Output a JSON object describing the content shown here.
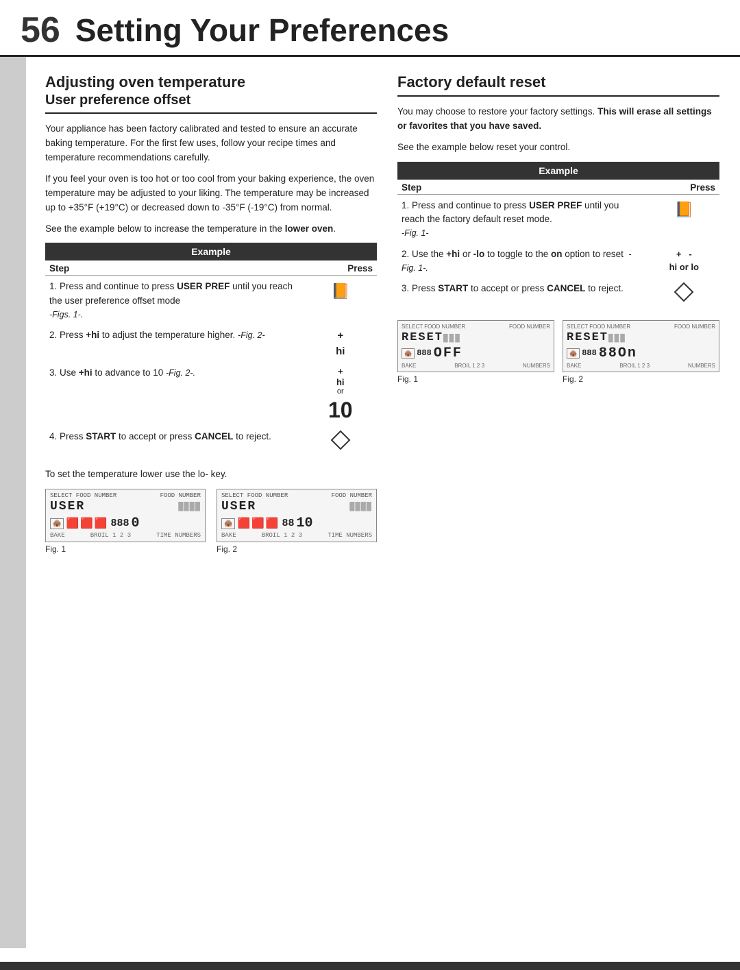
{
  "header": {
    "page_number": "56",
    "title": "Setting Your Preferences"
  },
  "left_section": {
    "title": "Adjusting oven temperature",
    "subtitle": "User preference offset",
    "paragraphs": [
      "Your appliance has been factory calibrated and tested to ensure an accurate baking temperature. For the first few uses, follow your recipe times and temperature recommendations carefully.",
      "If you feel your oven is too hot or too cool from your baking experience, the oven temperature may be adjusted to your liking. The temperature may be increased  up to +35°F (+19°C) or decreased down to -35°F (-19°C) from normal.",
      "See the example below to increase the temperature in the lower oven."
    ],
    "example_label": "Example",
    "step_label": "Step",
    "press_label": "Press",
    "steps": [
      {
        "number": "1.",
        "text": "Press and continue to press USER PREF until you reach the user preference offset mode",
        "italic": "-Figs. 1-.",
        "press": "user-pref-icon"
      },
      {
        "number": "2.",
        "text": "Press +hi to adjust the temperature higher.",
        "italic": "-Fig. 2-",
        "press": "+ hi"
      },
      {
        "number": "3.",
        "text": "Use +hi to advance to 10",
        "italic": "-Fig. 2-.",
        "press": "+ hi or 10"
      },
      {
        "number": "4.",
        "text": "Press START to accept or press CANCEL to reject.",
        "italic": "",
        "press": "start-icon"
      }
    ],
    "footer_note": "To set the temperature lower use the lo- key.",
    "fig1_label": "Fig. 1",
    "fig2_label": "Fig. 2"
  },
  "right_section": {
    "title": "Factory default reset",
    "paragraphs": [
      "You may choose to restore your factory settings.",
      "This will erase all settings or favorites that you have saved.",
      "See the example below reset your control."
    ],
    "example_label": "Example",
    "step_label": "Step",
    "press_label": "Press",
    "steps": [
      {
        "number": "1.",
        "text": "Press and continue to press USER PREF until you reach the factory default reset mode.",
        "italic": "-Fig. 1-",
        "press": "user-pref-icon"
      },
      {
        "number": "2.",
        "text": "Use the +hi or -lo to toggle to the on option to reset",
        "italic": "-Fig. 1-.",
        "press": "+ - hi or lo"
      },
      {
        "number": "3.",
        "text": "Press START to accept or press CANCEL to reject.",
        "italic": "",
        "press": "start-icon"
      }
    ],
    "fig1_label": "Fig. 1",
    "fig2_label": "Fig. 2"
  }
}
